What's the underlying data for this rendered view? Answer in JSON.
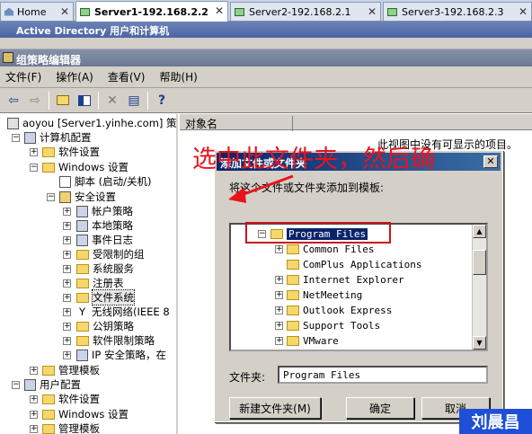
{
  "browser_tabs": [
    {
      "label": "Home",
      "active": false
    },
    {
      "label": "Server1-192.168.2.2",
      "active": true
    },
    {
      "label": "Server2-192.168.2.1",
      "active": false
    },
    {
      "label": "Server3-192.168.2.3",
      "active": false
    }
  ],
  "tab_close_glyph": "✕",
  "ad_window_title": "Active Directory 用户和计算机",
  "gp_window_title": "组策略编辑器",
  "menu": [
    "文件(F)",
    "操作(A)",
    "查看(V)",
    "帮助(H)"
  ],
  "toolbar_icons": [
    "back-icon",
    "forward-icon",
    "up-folder-icon",
    "show-hide-tree-icon",
    "delete-icon",
    "export-icon",
    "help-icon"
  ],
  "tree": {
    "root": "aoyou [Server1.yinhe.com] 策",
    "computer_config": "计算机配置",
    "software_settings": "软件设置",
    "windows_settings": "Windows 设置",
    "scripts": "脚本 (启动/关机)",
    "security_settings": "安全设置",
    "account_policy": "帐户策略",
    "local_policy": "本地策略",
    "event_log": "事件日志",
    "restricted_groups": "受限制的组",
    "system_services": "系统服务",
    "registry": "注册表",
    "file_system": "文件系统",
    "wireless": "无线网络(IEEE 8",
    "public_key": "公钥策略",
    "software_restriction": "软件限制策略",
    "ip_security": "IP 安全策略，在",
    "admin_templates": "管理模板",
    "user_config": "用户配置",
    "user_software_settings": "软件设置",
    "user_windows_settings": "Windows 设置",
    "user_admin_templates": "管理模板"
  },
  "list_header": "对象名",
  "empty_message": "此视图中没有可显示的项目。",
  "annotation": "选中此文件夹，然后确",
  "dialog": {
    "title": "添加文件或文件夹",
    "prompt": "将这个文件或文件夹添加到模板:",
    "items": [
      "Program Files",
      "Common Files",
      "ComPlus Applications",
      "Internet Explorer",
      "NetMeeting",
      "Outlook Express",
      "Support Tools",
      "VMware"
    ],
    "folder_label": "文件夹:",
    "folder_value": "Program Files",
    "new_folder_button": "新建文件夹(M)",
    "ok_button": "确定",
    "cancel_button": "取消"
  },
  "watermark": "刘晨昌",
  "colors": {
    "annotation_red": "#e8141c",
    "watermark_blue": "#1f4fd6",
    "dialog_title_blue": "#0a246a"
  }
}
